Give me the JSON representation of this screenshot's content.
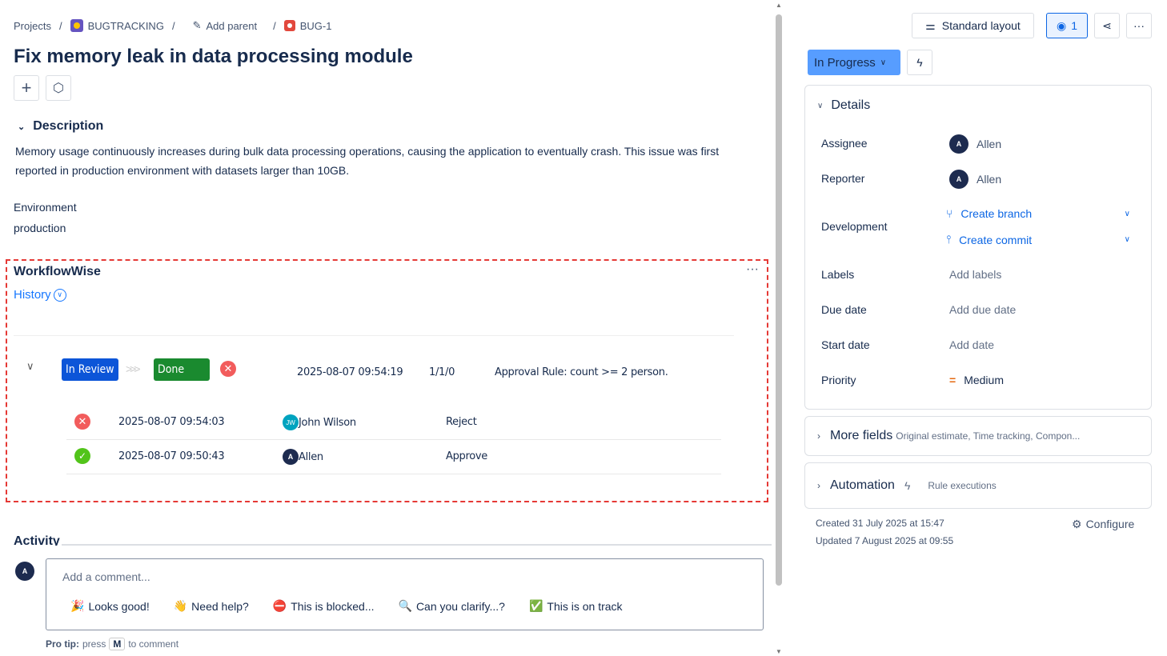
{
  "breadcrumb": {
    "projects": "Projects",
    "project": "BUGTRACKING",
    "add_parent": "Add parent",
    "issue_key": "BUG-1"
  },
  "issue": {
    "title": "Fix memory leak in data processing module"
  },
  "description": {
    "heading": "Description",
    "text": "Memory usage continuously increases during bulk data processing operations, causing the application to eventually crash. This issue was first reported in production environment with datasets larger than 10GB."
  },
  "environment": {
    "label": "Environment",
    "value": "production"
  },
  "workflow": {
    "title": "WorkflowWise",
    "history_label": "History",
    "transition": {
      "from": "In Review",
      "to": "Done",
      "from_color": "#0c55d8",
      "to_color": "#1a8a2f",
      "timestamp": "2025-08-07 09:54:19",
      "counts": "1/1/0",
      "rule": "Approval Rule: count >= 2 person."
    },
    "approvals": [
      {
        "status": "reject",
        "timestamp": "2025-08-07 09:54:03",
        "initials": "JW",
        "user": "John Wilson",
        "action": "Reject"
      },
      {
        "status": "approve",
        "timestamp": "2025-08-07 09:50:43",
        "initials": "A",
        "user": "Allen",
        "action": "Approve"
      }
    ]
  },
  "activity": {
    "heading": "Activity",
    "avatar": "A",
    "placeholder": "Add a comment...",
    "quick_replies": [
      {
        "icon": "🎉",
        "label": "Looks good!"
      },
      {
        "icon": "👋",
        "label": "Need help?"
      },
      {
        "icon": "⛔",
        "label": "This is blocked..."
      },
      {
        "icon": "🔍",
        "label": "Can you clarify...?"
      },
      {
        "icon": "✅",
        "label": "This is on track"
      }
    ],
    "tip_bold": "Pro tip:",
    "tip_pre": "press",
    "tip_key": "M",
    "tip_post": "to comment"
  },
  "toolbar": {
    "layout": "Standard layout",
    "watchers": "1"
  },
  "status": {
    "label": "In Progress",
    "color": "#579dff"
  },
  "details": {
    "heading": "Details",
    "assignee_label": "Assignee",
    "assignee": "Allen",
    "assignee_initial": "A",
    "reporter_label": "Reporter",
    "reporter": "Allen",
    "reporter_initial": "A",
    "development_label": "Development",
    "create_branch": "Create branch",
    "create_commit": "Create commit",
    "labels_label": "Labels",
    "labels_value": "Add labels",
    "due_label": "Due date",
    "due_value": "Add due date",
    "start_label": "Start date",
    "start_value": "Add date",
    "priority_label": "Priority",
    "priority_value": "Medium"
  },
  "more_fields": {
    "title": "More fields",
    "hint": "Original estimate, Time tracking, Compon..."
  },
  "automation": {
    "title": "Automation",
    "hint": "Rule executions"
  },
  "meta": {
    "created": "Created 31 July 2025 at 15:47",
    "updated": "Updated 7 August 2025 at 09:55",
    "configure": "Configure"
  }
}
